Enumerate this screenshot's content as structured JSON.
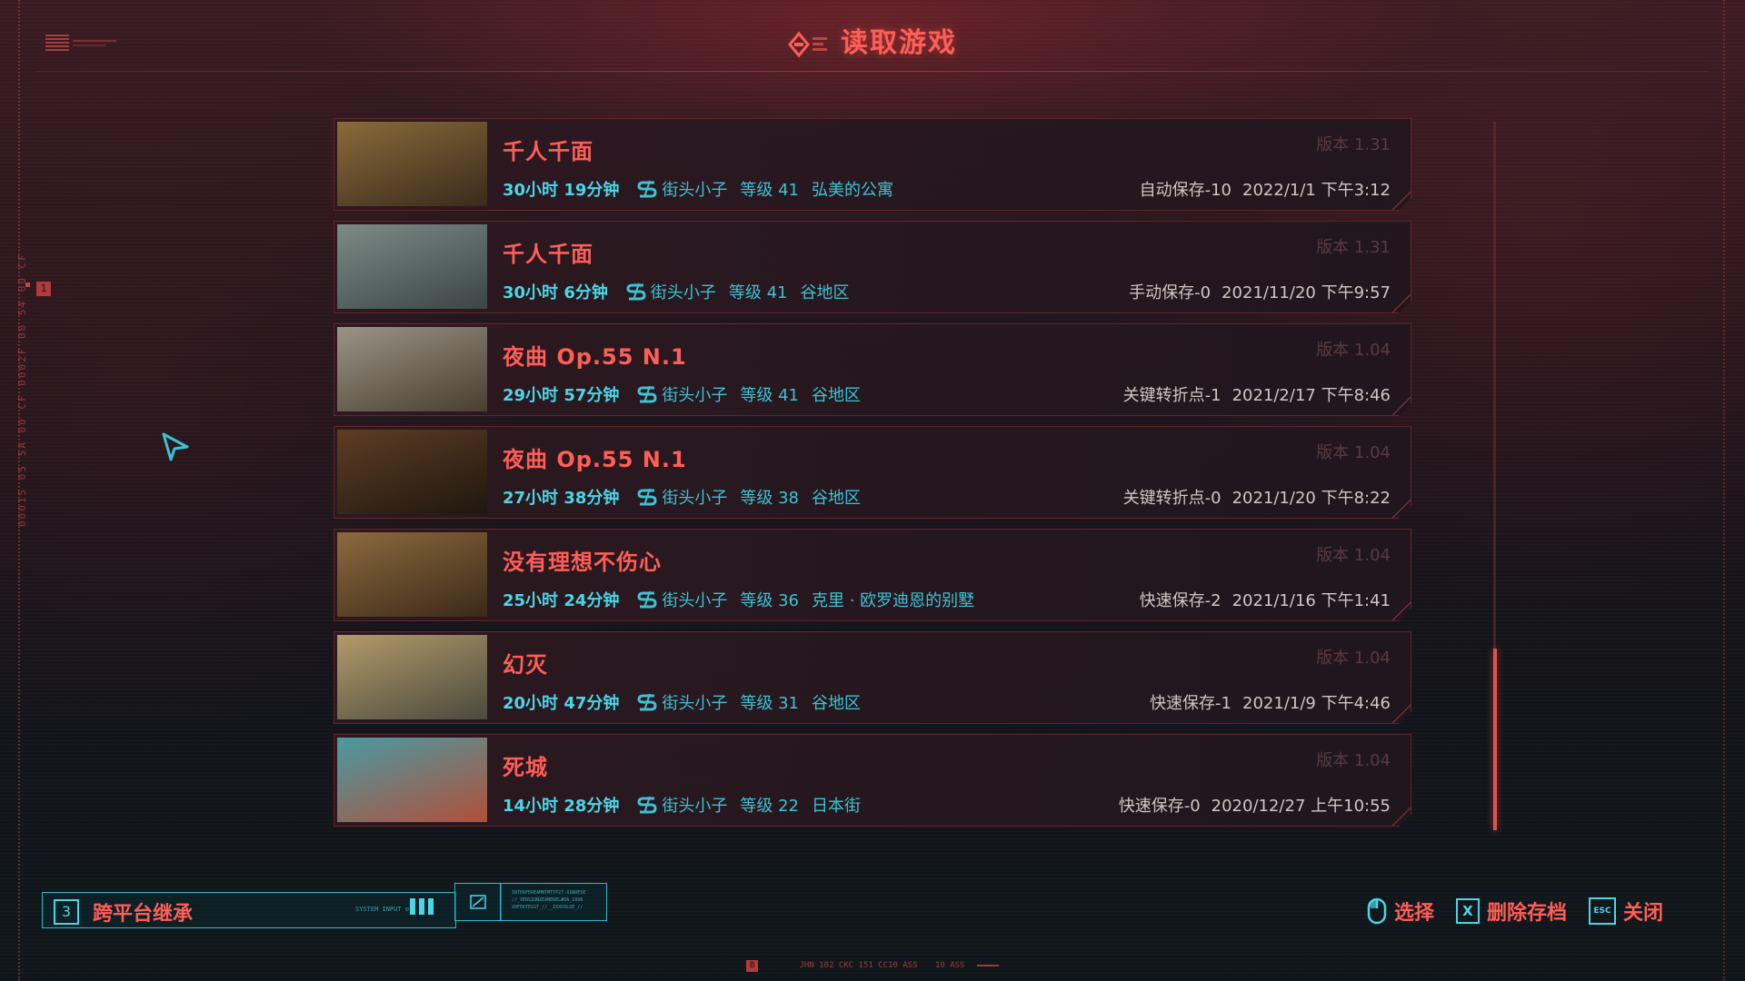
{
  "header": {
    "title": "读取游戏",
    "icon": "save-disc-icon"
  },
  "side_text": "00015 05 5A 00 CF 0002F 00 54 00 CF",
  "side_badge": "1",
  "saves": [
    {
      "name": "千人千面",
      "version": "版本 1.31",
      "playtime": "30小时 19分钟",
      "lifepath_icon": "street-kid-icon",
      "lifepath": "街头小子",
      "level": "等级 41",
      "location": "弘美的公寓",
      "save_type": "自动保存-10",
      "date": "2022/1/1 下午3:12",
      "thumb_colors": [
        "#8a6a3a",
        "#3a2b1c"
      ]
    },
    {
      "name": "千人千面",
      "version": "版本 1.31",
      "playtime": "30小时 6分钟",
      "lifepath_icon": "street-kid-icon",
      "lifepath": "街头小子",
      "level": "等级 41",
      "location": "谷地区",
      "save_type": "手动保存-0",
      "date": "2021/11/20 下午9:57",
      "thumb_colors": [
        "#7d8a86",
        "#3b4644"
      ]
    },
    {
      "name": "夜曲 Op.55 N.1",
      "version": "版本 1.04",
      "playtime": "29小时 57分钟",
      "lifepath_icon": "street-kid-icon",
      "lifepath": "街头小子",
      "level": "等级 41",
      "location": "谷地区",
      "save_type": "关键转折点-1",
      "date": "2021/2/17 下午8:46",
      "thumb_colors": [
        "#9a9486",
        "#4a3e30"
      ]
    },
    {
      "name": "夜曲 Op.55 N.1",
      "version": "版本 1.04",
      "playtime": "27小时 38分钟",
      "lifepath_icon": "street-kid-icon",
      "lifepath": "街头小子",
      "level": "等级 38",
      "location": "谷地区",
      "save_type": "关键转折点-0",
      "date": "2021/1/20 下午8:22",
      "thumb_colors": [
        "#5e3d24",
        "#1f170f"
      ]
    },
    {
      "name": "没有理想不伤心",
      "version": "版本 1.04",
      "playtime": "25小时 24分钟",
      "lifepath_icon": "street-kid-icon",
      "lifepath": "街头小子",
      "level": "等级 36",
      "location": "克里 · 欧罗迪恩的别墅",
      "save_type": "快速保存-2",
      "date": "2021/1/16 下午1:41",
      "thumb_colors": [
        "#8c6a3e",
        "#3b2a18"
      ]
    },
    {
      "name": "幻灭",
      "version": "版本 1.04",
      "playtime": "20小时 47分钟",
      "lifepath_icon": "street-kid-icon",
      "lifepath": "街头小子",
      "level": "等级 31",
      "location": "谷地区",
      "save_type": "快速保存-1",
      "date": "2021/1/9 下午4:46",
      "thumb_colors": [
        "#b39a6a",
        "#4a4a3e"
      ]
    },
    {
      "name": "死城",
      "version": "版本 1.04",
      "playtime": "14小时 28分钟",
      "lifepath_icon": "street-kid-icon",
      "lifepath": "街头小子",
      "level": "等级 22",
      "location": "日本街",
      "save_type": "快速保存-0",
      "date": "2020/12/27 上午10:55",
      "thumb_colors": [
        "#4a9aa2",
        "#b0503a"
      ]
    }
  ],
  "crossplay": {
    "key": "3",
    "label": "跨平台继承",
    "system_input": "SYSTEM INPUT ⊙",
    "data_text": "INTERFEREAMNTMTTP27-X1NRESE\n//_VERSIONXEANEREL#DA_1998\nX0FEKTEGST_//__ZXXOXLOE_//"
  },
  "hints": {
    "select_label": "选择",
    "select_icon": "mouse-icon",
    "delete_key": "X",
    "delete_label": "删除存档",
    "close_key": "ESC",
    "close_label": "关闭"
  },
  "footer": {
    "badge": "B",
    "code": "JHN 102 CKC 151 CC10 ASS",
    "code2": "10 ASS"
  },
  "scrollbar": {
    "position_fraction": 0.74,
    "visible_fraction": 0.26
  },
  "colors": {
    "accent_red": "#ff5e57",
    "accent_cyan": "#4ad6e6",
    "version_text": "#5a3a40",
    "meta_right_text": "#cfc7c2"
  }
}
